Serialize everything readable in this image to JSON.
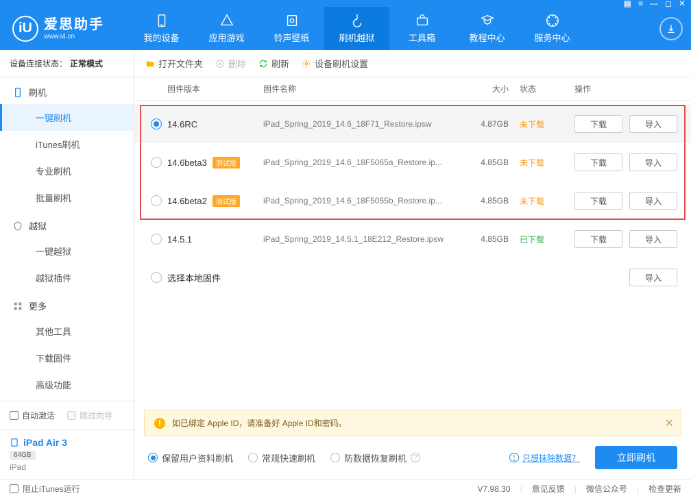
{
  "brand": {
    "cn": "爱思助手",
    "url": "www.i4.cn"
  },
  "nav": [
    "我的设备",
    "应用游戏",
    "铃声壁纸",
    "刷机越狱",
    "工具箱",
    "教程中心",
    "服务中心"
  ],
  "conn": {
    "label": "设备连接状态：",
    "value": "正常模式"
  },
  "sidebar": {
    "g1": "刷机",
    "g1_items": [
      "一键刷机",
      "iTunes刷机",
      "专业刷机",
      "批量刷机"
    ],
    "g2": "越狱",
    "g2_items": [
      "一键越狱",
      "越狱插件"
    ],
    "g3": "更多",
    "g3_items": [
      "其他工具",
      "下载固件",
      "高级功能"
    ]
  },
  "side_opts": {
    "auto": "自动激活",
    "skip": "跳过向导"
  },
  "device": {
    "name": "iPad Air 3",
    "storage": "64GB",
    "model": "iPad"
  },
  "toolbar": {
    "open": "打开文件夹",
    "del": "删除",
    "refresh": "刷新",
    "settings": "设备刷机设置"
  },
  "cols": {
    "ver": "固件版本",
    "name": "固件名称",
    "size": "大小",
    "status": "状态",
    "ops": "操作"
  },
  "badge_beta": "测试版",
  "btn_dl": "下载",
  "btn_import": "导入",
  "rows": [
    {
      "ver": "14.6RC",
      "beta": false,
      "name": "iPad_Spring_2019_14.6_18F71_Restore.ipsw",
      "size": "4.87GB",
      "status": "未下载",
      "sc": "nd",
      "sel": true
    },
    {
      "ver": "14.6beta3",
      "beta": true,
      "name": "iPad_Spring_2019_14.6_18F5065a_Restore.ip...",
      "size": "4.85GB",
      "status": "未下载",
      "sc": "nd",
      "sel": false
    },
    {
      "ver": "14.6beta2",
      "beta": true,
      "name": "iPad_Spring_2019_14.6_18F5055b_Restore.ip...",
      "size": "4.85GB",
      "status": "未下载",
      "sc": "nd",
      "sel": false
    },
    {
      "ver": "14.5.1",
      "beta": false,
      "name": "iPad_Spring_2019_14.5.1_18E212_Restore.ipsw",
      "size": "4.85GB",
      "status": "已下载",
      "sc": "dl",
      "sel": false
    }
  ],
  "local_row": "选择本地固件",
  "notice": "如已绑定 Apple ID，请准备好 Apple ID和密码。",
  "opts": {
    "o1": "保留用户资料刷机",
    "o2": "常规快速刷机",
    "o3": "防数据恢复刷机"
  },
  "wipe": "只想抹除数据？",
  "flash": "立即刷机",
  "footer": {
    "block": "阻止iTunes运行",
    "ver": "V7.98.30",
    "fb": "意见反馈",
    "wx": "微信公众号",
    "upd": "检查更新"
  }
}
